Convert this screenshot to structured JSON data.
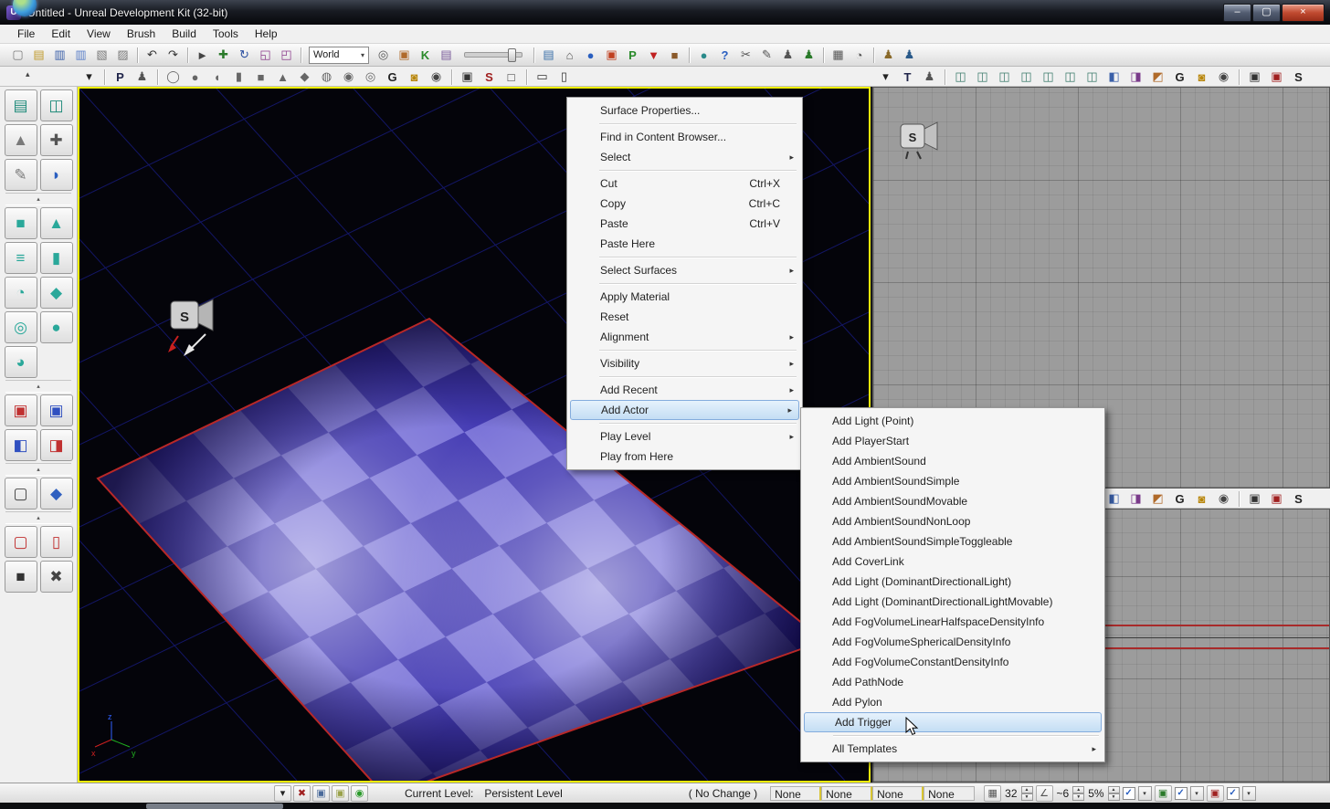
{
  "window": {
    "title": "Untitled - Unreal Development Kit (32-bit)",
    "icon_letter": "U",
    "controls": [
      {
        "name": "minimize-button",
        "glyph": "–"
      },
      {
        "name": "maximize-button",
        "glyph": "▢"
      },
      {
        "name": "close-button",
        "glyph": "×"
      }
    ]
  },
  "glyphs": {
    "check": "✓",
    "up": "▲",
    "down": "▼",
    "drop": "▾",
    "menu_arrow": "▸",
    "divider_arrow": "▴",
    "collapse_arrow": "▴"
  },
  "menu_bar": {
    "items": [
      "File",
      "Edit",
      "View",
      "Brush",
      "Build",
      "Tools",
      "Help"
    ]
  },
  "toolbar_main": {
    "items": [
      {
        "name": "new-map-icon",
        "glyph": "▢",
        "color": "#7a7a7a"
      },
      {
        "name": "open-map-icon",
        "glyph": "▤",
        "color": "#c09a2a"
      },
      {
        "name": "save-map-icon",
        "glyph": "▥",
        "color": "#3a5fa8"
      },
      {
        "name": "save-all-icon",
        "glyph": "▥",
        "color": "#5a7fc8"
      },
      {
        "name": "import-map-icon",
        "glyph": "▧",
        "color": "#7a7a7a"
      },
      {
        "name": "export-map-icon",
        "glyph": "▨",
        "color": "#7a7a7a"
      },
      {
        "sep": true
      },
      {
        "name": "undo-icon",
        "glyph": "↶",
        "color": "#333333"
      },
      {
        "name": "redo-icon",
        "glyph": "↷",
        "color": "#333333"
      },
      {
        "sep": true
      },
      {
        "name": "select-pointer-icon",
        "glyph": "►",
        "color": "#444444"
      },
      {
        "name": "translate-tool-icon",
        "glyph": "✚",
        "color": "#2a7a2a"
      },
      {
        "name": "rotate-tool-icon",
        "glyph": "↻",
        "color": "#2a4fa0"
      },
      {
        "name": "scale-tool-icon",
        "glyph": "◱",
        "color": "#8a3a8a"
      },
      {
        "name": "scale-axis-tool-icon",
        "glyph": "◰",
        "color": "#8a3a8a"
      },
      {
        "sep": true
      },
      {
        "type": "select",
        "name": "coordinate-system-select",
        "value": "World"
      },
      {
        "name": "search-binoculars-icon",
        "glyph": "◎",
        "color": "#555555"
      },
      {
        "name": "fullscreen-icon",
        "glyph": "▣",
        "color": "#b06a2a"
      },
      {
        "name": "kismet-icon",
        "glyph": "K",
        "color": "#2a8a2a",
        "bold": true
      },
      {
        "name": "content-browser-icon",
        "glyph": "▤",
        "color": "#7a5a9a"
      },
      {
        "type": "slider",
        "name": "camera-speed-slider"
      },
      {
        "sep": true
      },
      {
        "name": "generic-browser-icon",
        "glyph": "▤",
        "color": "#3a6fa8"
      },
      {
        "name": "building-browser-icon",
        "glyph": "⌂",
        "color": "#555555"
      },
      {
        "name": "world-sphere-icon",
        "glyph": "●",
        "color": "#2a5fc0"
      },
      {
        "name": "material-editor-icon",
        "glyph": "▣",
        "color": "#c04020"
      },
      {
        "name": "play-in-editor-icon",
        "glyph": "P",
        "color": "#2a8a2a",
        "bold": true
      },
      {
        "name": "publish-download-icon",
        "glyph": "▼",
        "color": "#c02020"
      },
      {
        "name": "package-icon",
        "glyph": "■",
        "color": "#8a5a2a"
      },
      {
        "sep": true
      },
      {
        "name": "online-globe-icon",
        "glyph": "●",
        "color": "#2a8a8a"
      },
      {
        "name": "help-icon",
        "glyph": "?",
        "color": "#2a5fc0",
        "bold": true
      },
      {
        "name": "cut-tool-icon",
        "glyph": "✂",
        "color": "#555555"
      },
      {
        "name": "edit-tool-icon",
        "glyph": "✎",
        "color": "#555555"
      },
      {
        "name": "actor-group-icon",
        "glyph": "♟",
        "color": "#555555"
      },
      {
        "name": "add-actor-toolbar-icon",
        "glyph": "♟",
        "color": "#2a7a2a"
      },
      {
        "sep": true
      },
      {
        "name": "grid-view-icon",
        "glyph": "▦",
        "color": "#555555"
      },
      {
        "name": "autosave-clock-icon",
        "glyph": "◔",
        "color": "#555555"
      },
      {
        "sep": true
      },
      {
        "name": "player-brown-icon",
        "glyph": "♟",
        "color": "#8a6a2a"
      },
      {
        "name": "player-blue-icon",
        "glyph": "♟",
        "color": "#2a5a8a"
      }
    ]
  },
  "viewport_toolbar": {
    "left_items": [
      {
        "name": "viewport-options-icon",
        "glyph": "▾",
        "color": "#222222"
      },
      {
        "sep": true
      },
      {
        "name": "perspective-label-icon",
        "glyph": "P",
        "color": "#20254a",
        "bold": true
      },
      {
        "name": "game-view-icon",
        "glyph": "♟",
        "color": "#555555"
      },
      {
        "sep": true
      },
      {
        "name": "show-brushes-icon",
        "glyph": "◯",
        "color": "#666666"
      },
      {
        "name": "show-meshes-icon",
        "glyph": "●",
        "color": "#666666"
      },
      {
        "name": "show-terrain-icon",
        "glyph": "◖",
        "color": "#666666"
      },
      {
        "name": "show-volumes-icon",
        "glyph": "▮",
        "color": "#666666"
      },
      {
        "name": "show-bsp-icon",
        "glyph": "■",
        "color": "#666666"
      },
      {
        "name": "show-cone-icon",
        "glyph": "▲",
        "color": "#666666"
      },
      {
        "name": "show-sprites-icon",
        "glyph": "◆",
        "color": "#666666"
      },
      {
        "name": "show-fog-icon",
        "glyph": "◍",
        "color": "#666666"
      },
      {
        "name": "show-paths-icon",
        "glyph": "◉",
        "color": "#666666"
      },
      {
        "name": "show-decals-icon",
        "glyph": "◎",
        "color": "#666666"
      },
      {
        "name": "show-flags-icon",
        "glyph": "G",
        "color": "#222222",
        "bold": true
      },
      {
        "name": "lock-viewport-icon",
        "glyph": "◙",
        "color": "#b8860b"
      },
      {
        "name": "show-eye-icon",
        "glyph": "◉",
        "color": "#444444"
      },
      {
        "sep": true
      },
      {
        "name": "camera-speed-icon",
        "glyph": "▣",
        "color": "#333333"
      },
      {
        "name": "squint-mode-icon",
        "glyph": "S",
        "color": "#a02020",
        "bold": true
      },
      {
        "name": "unlit-mode-icon",
        "glyph": "□",
        "color": "#333333"
      },
      {
        "sep": true
      },
      {
        "name": "matinee-preview-icon",
        "glyph": "▭",
        "color": "#333333"
      },
      {
        "name": "camera-lock-icon",
        "glyph": "▯",
        "color": "#333333"
      }
    ],
    "right_items": [
      {
        "name": "viewport-options-icon",
        "glyph": "▾",
        "color": "#222222"
      },
      {
        "name": "top-view-label-icon",
        "glyph": "T",
        "color": "#20254a",
        "bold": true
      },
      {
        "name": "game-view-icon",
        "glyph": "♟",
        "color": "#555555"
      },
      {
        "sep": true
      },
      {
        "name": "show-cube-1-icon",
        "glyph": "◫",
        "color": "#3a7a6a"
      },
      {
        "name": "show-cube-2-icon",
        "glyph": "◫",
        "color": "#3a7a6a"
      },
      {
        "name": "show-cube-3-icon",
        "glyph": "◫",
        "color": "#3a7a6a"
      },
      {
        "name": "show-cube-4-icon",
        "glyph": "◫",
        "color": "#3a7a6a"
      },
      {
        "name": "show-cube-5-icon",
        "glyph": "◫",
        "color": "#3a7a6a"
      },
      {
        "name": "show-cube-6-icon",
        "glyph": "◫",
        "color": "#3a7a6a"
      },
      {
        "name": "show-cube-7-icon",
        "glyph": "◫",
        "color": "#3a7a6a"
      },
      {
        "name": "show-cube-8-icon",
        "glyph": "◧",
        "color": "#3a5fa8"
      },
      {
        "name": "show-cube-9-icon",
        "glyph": "◨",
        "color": "#7a3a8a"
      },
      {
        "name": "show-cube-10-icon",
        "glyph": "◩",
        "color": "#b06a2a"
      },
      {
        "name": "show-flags-icon",
        "glyph": "G",
        "color": "#222222",
        "bold": true
      },
      {
        "name": "lock-viewport-icon",
        "glyph": "◙",
        "color": "#b8860b"
      },
      {
        "name": "show-eye-icon",
        "glyph": "◉",
        "color": "#444444"
      },
      {
        "sep": true
      },
      {
        "name": "camera-1-icon",
        "glyph": "▣",
        "color": "#333333"
      },
      {
        "name": "camera-2-icon",
        "glyph": "▣",
        "color": "#a02020"
      },
      {
        "name": "squint-mode-icon",
        "glyph": "S",
        "color": "#222222",
        "bold": true
      }
    ]
  },
  "left_panel": {
    "groups": [
      [
        {
          "name": "content-browser-button",
          "glyph": "▤",
          "color": "#1f8a7a"
        },
        {
          "name": "camera-mode-button",
          "glyph": "◫",
          "color": "#1f8a7a"
        },
        {
          "name": "terrain-mode-button",
          "glyph": "▲",
          "color": "#7a7a7a"
        },
        {
          "name": "translate-mode-button",
          "glyph": "✚",
          "color": "#555555"
        },
        {
          "name": "brush-wand-button",
          "glyph": "✎",
          "color": "#7a7a7a"
        },
        {
          "name": "geometry-mode-button",
          "glyph": "◗",
          "color": "#2a5fc0"
        }
      ],
      [
        {
          "name": "cube-builder-button",
          "glyph": "■",
          "color": "#2aa89a"
        },
        {
          "name": "cone-builder-button",
          "glyph": "▲",
          "color": "#2aa89a"
        },
        {
          "name": "stairs-builder-button",
          "glyph": "≡",
          "color": "#2aa89a"
        },
        {
          "name": "cylinder-builder-button",
          "glyph": "▮",
          "color": "#2aa89a"
        },
        {
          "name": "curved-stairs-builder-button",
          "glyph": "◔",
          "color": "#2aa89a"
        },
        {
          "name": "sheet-builder-button",
          "glyph": "◆",
          "color": "#2aa89a"
        },
        {
          "name": "spiral-stairs-builder-button",
          "glyph": "◎",
          "color": "#2aa89a"
        },
        {
          "name": "sphere-builder-button",
          "glyph": "●",
          "color": "#2aa89a"
        },
        {
          "name": "volume-builder-button",
          "glyph": "◕",
          "color": "#2aa89a"
        }
      ],
      [
        {
          "name": "csg-add-button",
          "glyph": "▣",
          "color": "#c03030"
        },
        {
          "name": "csg-subtract-button",
          "glyph": "▣",
          "color": "#3050c0"
        },
        {
          "name": "csg-intersect-button",
          "glyph": "◧",
          "color": "#3050c0"
        },
        {
          "name": "csg-deintersect-button",
          "glyph": "◨",
          "color": "#c03030"
        }
      ],
      [
        {
          "name": "select-box-button",
          "glyph": "▢",
          "color": "#444444"
        },
        {
          "name": "brush-clip-button",
          "glyph": "◆",
          "color": "#3060c0"
        }
      ],
      [
        {
          "name": "red-builder-cube-button",
          "glyph": "▢",
          "color": "#c03030"
        },
        {
          "name": "red-builder-cylinder-button",
          "glyph": "▯",
          "color": "#c03030"
        },
        {
          "name": "special-brush-button",
          "glyph": "■",
          "color": "#333333"
        },
        {
          "name": "delete-brush-button",
          "glyph": "✖",
          "color": "#444444"
        }
      ]
    ]
  },
  "viewport_main": {
    "speaker_label": "S",
    "axes": [
      "x",
      "y",
      "z"
    ]
  },
  "viewport_top": {
    "speaker_label": "S"
  },
  "context_menu": {
    "items": [
      {
        "label": "Surface Properties..."
      },
      {
        "sep": true
      },
      {
        "label": "Find in Content Browser..."
      },
      {
        "label": "Select",
        "arrow": true
      },
      {
        "sep": true
      },
      {
        "label": "Cut",
        "shortcut": "Ctrl+X"
      },
      {
        "label": "Copy",
        "shortcut": "Ctrl+C"
      },
      {
        "label": "Paste",
        "shortcut": "Ctrl+V"
      },
      {
        "label": "Paste Here"
      },
      {
        "sep": true
      },
      {
        "label": "Select Surfaces",
        "arrow": true
      },
      {
        "sep": true
      },
      {
        "label": "Apply Material"
      },
      {
        "label": "Reset"
      },
      {
        "label": "Alignment",
        "arrow": true
      },
      {
        "sep": true
      },
      {
        "label": "Visibility",
        "arrow": true
      },
      {
        "sep": true
      },
      {
        "label": "Add Recent",
        "arrow": true
      },
      {
        "label": "Add Actor",
        "arrow": true,
        "highlight": true
      },
      {
        "sep": true
      },
      {
        "label": "Play Level",
        "arrow": true
      },
      {
        "label": "Play from Here"
      }
    ]
  },
  "submenu": {
    "items": [
      {
        "label": "Add Light (Point)"
      },
      {
        "label": "Add PlayerStart"
      },
      {
        "label": "Add AmbientSound"
      },
      {
        "label": "Add AmbientSoundSimple"
      },
      {
        "label": "Add AmbientSoundMovable"
      },
      {
        "label": "Add AmbientSoundNonLoop"
      },
      {
        "label": "Add AmbientSoundSimpleToggleable"
      },
      {
        "label": "Add CoverLink"
      },
      {
        "label": "Add Light (DominantDirectionalLight)"
      },
      {
        "label": "Add Light (DominantDirectionalLightMovable)"
      },
      {
        "label": "Add FogVolumeLinearHalfspaceDensityInfo"
      },
      {
        "label": "Add FogVolumeSphericalDensityInfo"
      },
      {
        "label": "Add FogVolumeConstantDensityInfo"
      },
      {
        "label": "Add PathNode"
      },
      {
        "label": "Add Pylon"
      },
      {
        "label": "Add Trigger",
        "highlight": true
      },
      {
        "sep": true
      },
      {
        "label": "All Templates",
        "arrow": true
      }
    ]
  },
  "status_bar": {
    "left_icons": [
      {
        "name": "level-combo-drop-icon",
        "glyph": "▾",
        "color": "#222222"
      },
      {
        "name": "build-error-icon",
        "glyph": "✖",
        "color": "#a02020"
      },
      {
        "name": "lighting-status-icon",
        "glyph": "▣",
        "color": "#4a6a9a"
      },
      {
        "name": "paths-status-icon",
        "glyph": "▣",
        "color": "#9aa24a"
      },
      {
        "name": "network-status-icon",
        "glyph": "◉",
        "color": "#2a9a2a"
      }
    ],
    "current_level_label": "Current Level:",
    "current_level_value": "Persistent Level",
    "transaction": "( No Change )",
    "fields": [
      "None",
      "None",
      "None",
      "None"
    ],
    "drag_grid_icon": {
      "name": "drag-grid-icon",
      "glyph": "▦",
      "color": "#555555"
    },
    "drag_grid_value": "32",
    "rotation_grid_icon": {
      "name": "rotation-grid-icon",
      "glyph": "∠",
      "color": "#555555"
    },
    "rotation_grid_value": "~6",
    "autosave_value": "5%",
    "toggle_icons": [
      {
        "name": "realtime-status-icon",
        "glyph": "▣",
        "color": "#2a7a2a"
      },
      {
        "name": "lock-grid-status-icon",
        "glyph": "▣",
        "color": "#a02020"
      }
    ]
  }
}
